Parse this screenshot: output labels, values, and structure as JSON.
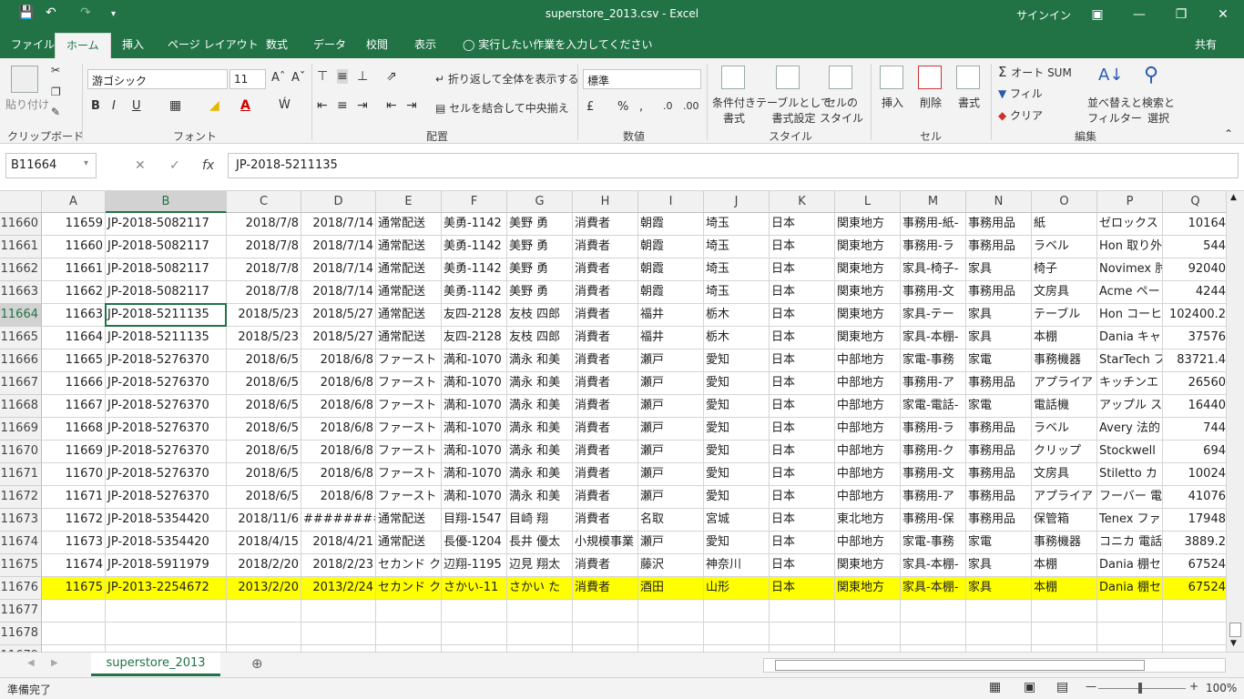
{
  "window": {
    "title": "superstore_2013.csv  -  Excel",
    "signin": "サインイン"
  },
  "menu": {
    "tabs": [
      "ファイル",
      "ホーム",
      "挿入",
      "ページ レイアウト",
      "数式",
      "データ",
      "校閲",
      "表示"
    ],
    "active": "ホーム",
    "tell_me": "実行したい作業を入力してください",
    "share": "共有"
  },
  "ribbon": {
    "clipboard": {
      "paste": "貼り付け",
      "label": "クリップボード"
    },
    "font": {
      "name": "游ゴシック",
      "size": "11",
      "label": "フォント"
    },
    "alignment": {
      "wrap": "折り返して全体を表示する",
      "merge": "セルを結合して中央揃え",
      "label": "配置"
    },
    "number": {
      "format": "標準",
      "label": "数値"
    },
    "styles": {
      "conditional": "条件付き\n書式",
      "table": "テーブルとして\n書式設定",
      "cell": "セルの\nスタイル",
      "label": "スタイル"
    },
    "cells": {
      "insert": "挿入",
      "delete": "削除",
      "format": "書式",
      "label": "セル"
    },
    "editing": {
      "autosum": "オート SUM",
      "fill": "フィル",
      "clear": "クリア",
      "sort": "並べ替えと\nフィルター",
      "find": "検索と\n選択",
      "label": "編集"
    }
  },
  "formula_bar": {
    "name_box": "B11664",
    "value": "JP-2018-5211135"
  },
  "columns": [
    "A",
    "B",
    "C",
    "D",
    "E",
    "F",
    "G",
    "H",
    "I",
    "J",
    "K",
    "L",
    "M",
    "N",
    "O",
    "P",
    "Q"
  ],
  "rows": [
    {
      "n": "11660",
      "cells": [
        "11659",
        "JP-2018-5082117",
        "2018/7/8",
        "2018/7/14",
        "通常配送",
        "美勇-1142",
        "美野 勇",
        "消費者",
        "朝霞",
        "埼玉",
        "日本",
        "関東地方",
        "事務用-紙-",
        "事務用品",
        "紙",
        "ゼロックス",
        "10164"
      ]
    },
    {
      "n": "11661",
      "cells": [
        "11660",
        "JP-2018-5082117",
        "2018/7/8",
        "2018/7/14",
        "通常配送",
        "美勇-1142",
        "美野 勇",
        "消費者",
        "朝霞",
        "埼玉",
        "日本",
        "関東地方",
        "事務用-ラ",
        "事務用品",
        "ラベル",
        "Hon 取り外",
        "544"
      ]
    },
    {
      "n": "11662",
      "cells": [
        "11661",
        "JP-2018-5082117",
        "2018/7/8",
        "2018/7/14",
        "通常配送",
        "美勇-1142",
        "美野 勇",
        "消費者",
        "朝霞",
        "埼玉",
        "日本",
        "関東地方",
        "家具-椅子-",
        "家具",
        "椅子",
        "Novimex 肘",
        "92040"
      ]
    },
    {
      "n": "11663",
      "cells": [
        "11662",
        "JP-2018-5082117",
        "2018/7/8",
        "2018/7/14",
        "通常配送",
        "美勇-1142",
        "美野 勇",
        "消費者",
        "朝霞",
        "埼玉",
        "日本",
        "関東地方",
        "事務用-文",
        "事務用品",
        "文房具",
        "Acme ペー",
        "4244"
      ]
    },
    {
      "n": "11664",
      "cells": [
        "11663",
        "JP-2018-5211135",
        "2018/5/23",
        "2018/5/27",
        "通常配送",
        "友四-2128",
        "友枝 四郎",
        "消費者",
        "福井",
        "栃木",
        "日本",
        "関東地方",
        "家具-テー",
        "家具",
        "テーブル",
        "Hon コーヒ",
        "102400.2"
      ]
    },
    {
      "n": "11665",
      "cells": [
        "11664",
        "JP-2018-5211135",
        "2018/5/23",
        "2018/5/27",
        "通常配送",
        "友四-2128",
        "友枝 四郎",
        "消費者",
        "福井",
        "栃木",
        "日本",
        "関東地方",
        "家具-本棚-",
        "家具",
        "本棚",
        "Dania キャ",
        "37576"
      ]
    },
    {
      "n": "11666",
      "cells": [
        "11665",
        "JP-2018-5276370",
        "2018/6/5",
        "2018/6/8",
        "ファースト",
        "満和-1070",
        "満永 和美",
        "消費者",
        "瀬戸",
        "愛知",
        "日本",
        "中部地方",
        "家電-事務",
        "家電",
        "事務機器",
        "StarTech フ",
        "83721.4"
      ]
    },
    {
      "n": "11667",
      "cells": [
        "11666",
        "JP-2018-5276370",
        "2018/6/5",
        "2018/6/8",
        "ファースト",
        "満和-1070",
        "満永 和美",
        "消費者",
        "瀬戸",
        "愛知",
        "日本",
        "中部地方",
        "事務用-ア",
        "事務用品",
        "アプライア",
        "キッチンエ",
        "26560"
      ]
    },
    {
      "n": "11668",
      "cells": [
        "11667",
        "JP-2018-5276370",
        "2018/6/5",
        "2018/6/8",
        "ファースト",
        "満和-1070",
        "満永 和美",
        "消費者",
        "瀬戸",
        "愛知",
        "日本",
        "中部地方",
        "家電-電話-",
        "家電",
        "電話機",
        "アップル ス",
        "16440"
      ]
    },
    {
      "n": "11669",
      "cells": [
        "11668",
        "JP-2018-5276370",
        "2018/6/5",
        "2018/6/8",
        "ファースト",
        "満和-1070",
        "満永 和美",
        "消費者",
        "瀬戸",
        "愛知",
        "日本",
        "中部地方",
        "事務用-ラ",
        "事務用品",
        "ラベル",
        "Avery 法的",
        "744"
      ]
    },
    {
      "n": "11670",
      "cells": [
        "11669",
        "JP-2018-5276370",
        "2018/6/5",
        "2018/6/8",
        "ファースト",
        "満和-1070",
        "満永 和美",
        "消費者",
        "瀬戸",
        "愛知",
        "日本",
        "中部地方",
        "事務用-ク",
        "事務用品",
        "クリップ",
        "Stockwell",
        "694"
      ]
    },
    {
      "n": "11671",
      "cells": [
        "11670",
        "JP-2018-5276370",
        "2018/6/5",
        "2018/6/8",
        "ファースト",
        "満和-1070",
        "満永 和美",
        "消費者",
        "瀬戸",
        "愛知",
        "日本",
        "中部地方",
        "事務用-文",
        "事務用品",
        "文房具",
        "Stiletto カ",
        "10024"
      ]
    },
    {
      "n": "11672",
      "cells": [
        "11671",
        "JP-2018-5276370",
        "2018/6/5",
        "2018/6/8",
        "ファースト",
        "満和-1070",
        "満永 和美",
        "消費者",
        "瀬戸",
        "愛知",
        "日本",
        "中部地方",
        "事務用-ア",
        "事務用品",
        "アプライア",
        "フーバー 電",
        "41076"
      ]
    },
    {
      "n": "11673",
      "cells": [
        "11672",
        "JP-2018-5354420",
        "2018/11/6",
        "########",
        "通常配送",
        "目翔-1547",
        "目崎 翔",
        "消費者",
        "名取",
        "宮城",
        "日本",
        "東北地方",
        "事務用-保",
        "事務用品",
        "保管箱",
        "Tenex ファ",
        "17948"
      ]
    },
    {
      "n": "11674",
      "cells": [
        "11673",
        "JP-2018-5354420",
        "2018/4/15",
        "2018/4/21",
        "通常配送",
        "長優-1204",
        "長井 優太",
        "小規模事業",
        "瀬戸",
        "愛知",
        "日本",
        "中部地方",
        "家電-事務",
        "家電",
        "事務機器",
        "コニカ 電話",
        "3889.2"
      ]
    },
    {
      "n": "11675",
      "cells": [
        "11674",
        "JP-2018-5911979",
        "2018/2/20",
        "2018/2/23",
        "セカンド ク",
        "辺翔-1195",
        "辺見 翔太",
        "消費者",
        "藤沢",
        "神奈川",
        "日本",
        "関東地方",
        "家具-本棚-",
        "家具",
        "本棚",
        "Dania 棚セ",
        "67524"
      ]
    },
    {
      "n": "11676",
      "cells": [
        "11675",
        "JP-2013-2254672",
        "2013/2/20",
        "2013/2/24",
        "セカンド ク",
        "さかい-11",
        "さかい た",
        "消費者",
        "酒田",
        "山形",
        "日本",
        "関東地方",
        "家具-本棚-",
        "家具",
        "本棚",
        "Dania 棚セ",
        "67524"
      ]
    },
    {
      "n": "11677",
      "cells": [
        "",
        "",
        "",
        "",
        "",
        "",
        "",
        "",
        "",
        "",
        "",
        "",
        "",
        "",
        "",
        "",
        ""
      ]
    },
    {
      "n": "11678",
      "cells": [
        "",
        "",
        "",
        "",
        "",
        "",
        "",
        "",
        "",
        "",
        "",
        "",
        "",
        "",
        "",
        "",
        ""
      ]
    },
    {
      "n": "11679",
      "cells": [
        "",
        "",
        "",
        "",
        "",
        "",
        "",
        "",
        "",
        "",
        "",
        "",
        "",
        "",
        "",
        "",
        ""
      ]
    }
  ],
  "highlight_row": "11676",
  "selected_row": "11664",
  "selected_col": "B",
  "sheet": {
    "name": "superstore_2013"
  },
  "status": {
    "ready": "準備完了",
    "zoom": "100%"
  },
  "colors": {
    "excel_green": "#217346",
    "highlight": "#ffff00"
  }
}
